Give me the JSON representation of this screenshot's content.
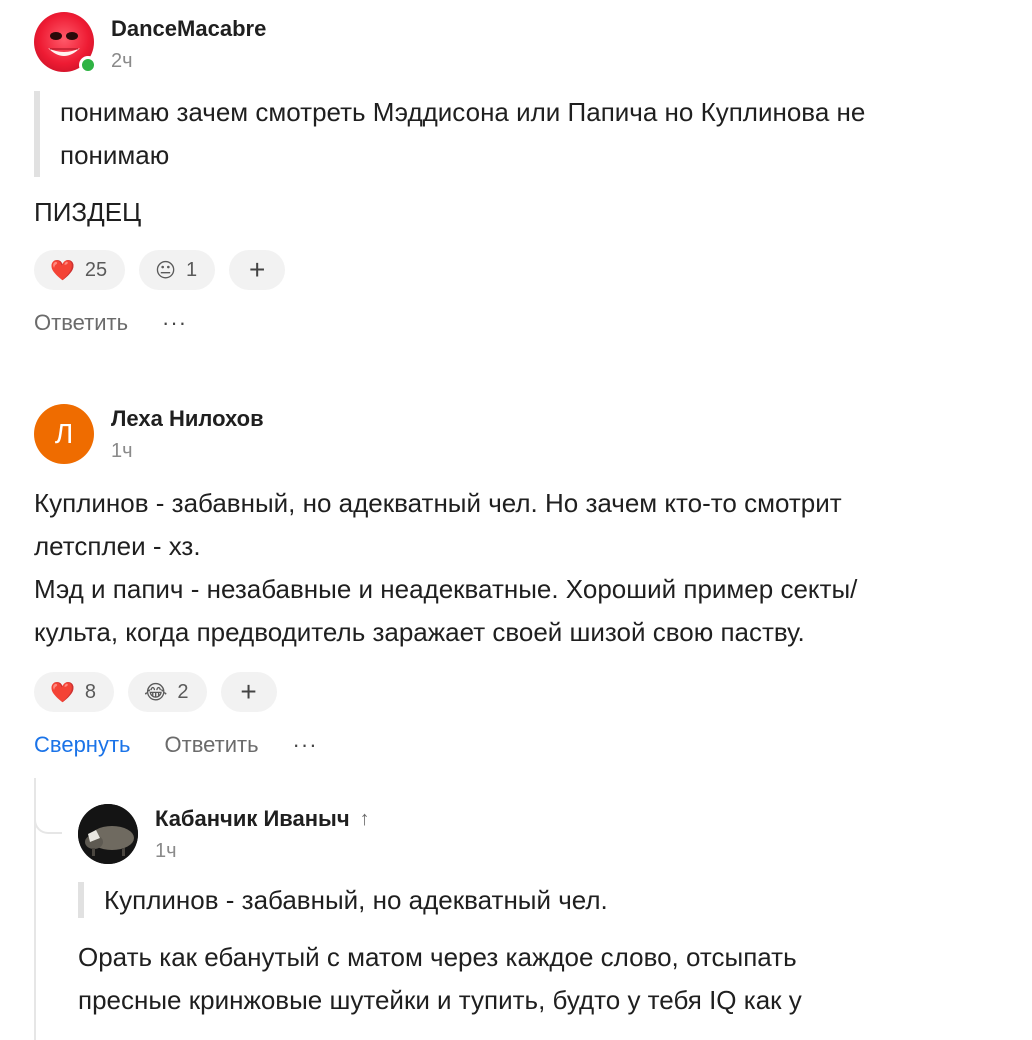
{
  "comments": [
    {
      "author": "DanceMacabre",
      "time": "2ч",
      "quote": "понимаю зачем смотреть Мэддисона или Папича но Куплинова не понимаю",
      "text": "ПИЗДЕЦ",
      "reactions": [
        {
          "emoji": "❤️",
          "count": "25"
        },
        {
          "emoji": "😐",
          "count": "1"
        }
      ],
      "reply_label": "Ответить",
      "online": true
    },
    {
      "author": "Леха Нилохов",
      "avatar_letter": "Л",
      "time": "1ч",
      "text_lines": [
        "Куплинов - забавный, но адекватный чел. Но зачем кто-то смотрит",
        "летсплеи - хз.",
        "Мэд и папич - незабавные и неадекватные. Хороший пример секты/",
        "культа, когда предводитель заражает своей шизой свою паству."
      ],
      "reactions": [
        {
          "emoji": "❤️",
          "count": "8"
        },
        {
          "emoji": "😂",
          "count": "2"
        }
      ],
      "collapse_label": "Свернуть",
      "reply_label": "Ответить"
    },
    {
      "author": "Кабанчик Иваныч",
      "time": "1ч",
      "quote": "Куплинов - забавный, но адекватный чел.",
      "text_lines": [
        "Орать как ебанутый с матом через каждое слово, отсыпать",
        "пресные кринжовые шутейки и тупить, будто у тебя IQ как у"
      ]
    }
  ],
  "add_reaction_symbol": "+",
  "more_symbol": "···",
  "reply_up_arrow": "↑",
  "colors": {
    "online": "#2fb344",
    "link": "#1a73e8",
    "avatar_orange": "#ef6c00"
  }
}
